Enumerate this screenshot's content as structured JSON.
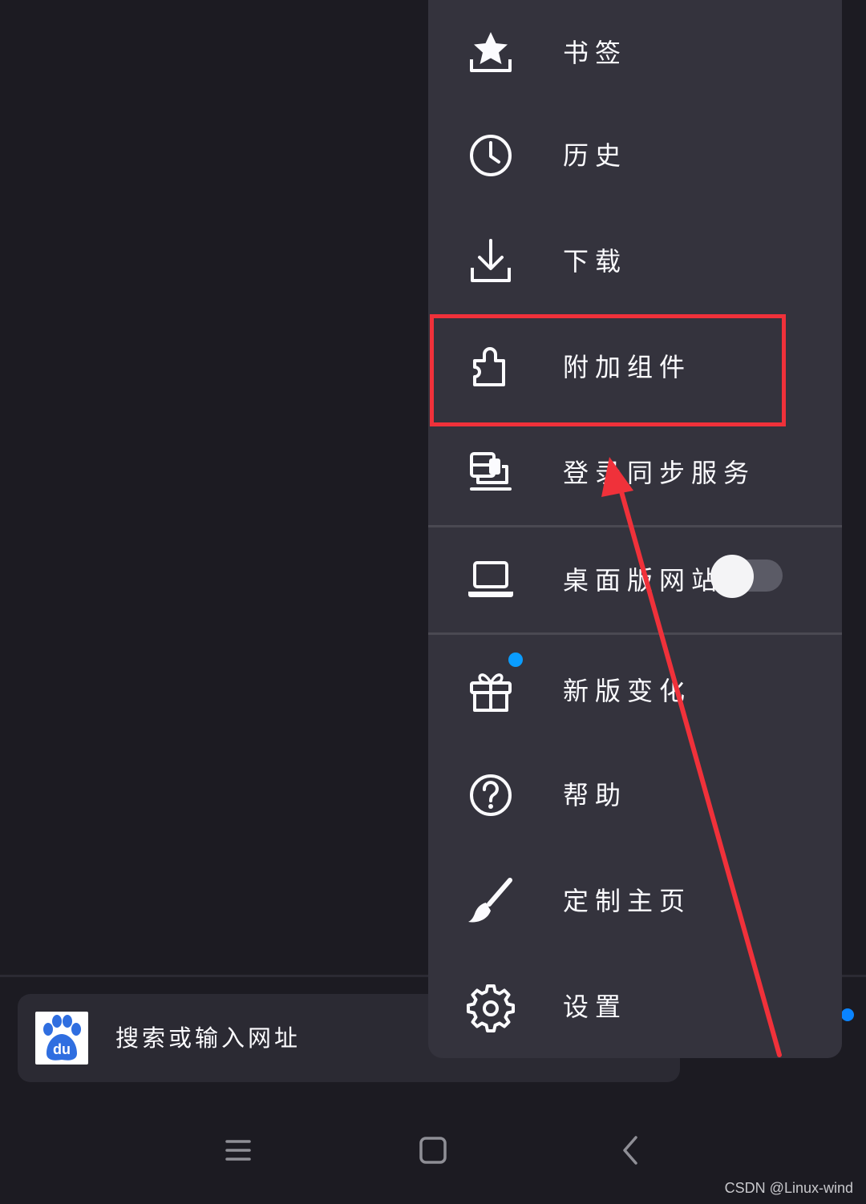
{
  "url_bar": {
    "placeholder": "搜索或输入网址",
    "site_icon": "baidu-paw-icon",
    "site_icon_text": "du"
  },
  "menu": {
    "items": [
      {
        "label": "书签",
        "icon": "bookmark-star-icon"
      },
      {
        "label": "历史",
        "icon": "clock-icon"
      },
      {
        "label": "下载",
        "icon": "download-icon"
      },
      {
        "label": "附加组件",
        "icon": "puzzle-icon"
      },
      {
        "label": "登录同步服务",
        "icon": "sync-devices-icon"
      },
      {
        "label": "桌面版网站",
        "icon": "laptop-icon",
        "toggle": false
      },
      {
        "label": "新版变化",
        "icon": "gift-icon",
        "badge": true
      },
      {
        "label": "帮助",
        "icon": "help-icon"
      },
      {
        "label": "定制主页",
        "icon": "brush-icon"
      },
      {
        "label": "设置",
        "icon": "gear-icon"
      }
    ]
  },
  "nav": {
    "recents_icon": "menu-lines-icon",
    "home_icon": "square-icon",
    "back_icon": "chevron-left-icon"
  },
  "watermark": "CSDN @Linux-wind",
  "colors": {
    "background": "#1c1b22",
    "menu_bg": "#34333d",
    "accent": "#0a84ff",
    "annotation": "#f0313a"
  }
}
